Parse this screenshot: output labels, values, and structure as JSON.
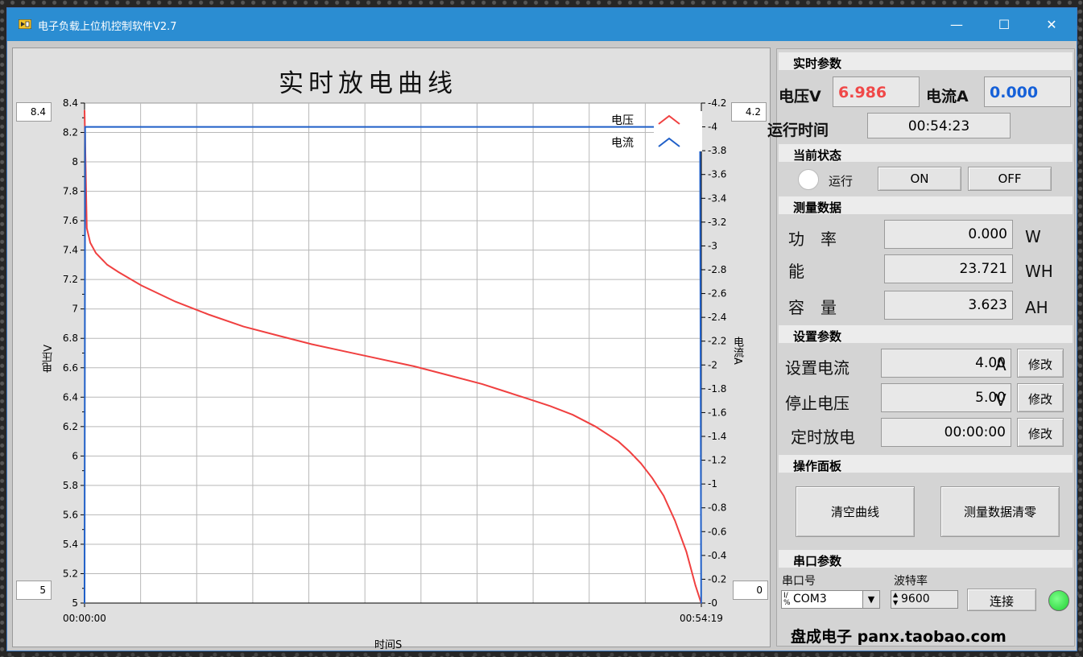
{
  "window": {
    "title": "电子负载上位机控制软件V2.7",
    "min": "—",
    "max": "☐",
    "close": "✕"
  },
  "chart": {
    "title": "实时放电曲线",
    "left_max_box": "8.4",
    "left_min_box": "5",
    "right_max_box": "4.2",
    "right_min_box": "0",
    "xlabel": "时间S",
    "ylabel_left": "电压V",
    "ylabel_right": "电流A",
    "x_start_label": "00:00:00",
    "x_end_label": "00:54:19",
    "legend": [
      "电压",
      "电流"
    ]
  },
  "chart_data": {
    "type": "line",
    "title": "实时放电曲线",
    "xlabel": "时间S",
    "ylabel": "电压V",
    "y2label": "电流A",
    "xlim": [
      "00:00:00",
      "00:54:19"
    ],
    "ylim": [
      5,
      8.4
    ],
    "y2lim": [
      0,
      4.2
    ],
    "yticks": [
      "5",
      "5.2",
      "5.4",
      "5.6",
      "5.8",
      "6",
      "6.2",
      "6.4",
      "6.6",
      "6.8",
      "7",
      "7.2",
      "7.4",
      "7.6",
      "7.8",
      "8",
      "8.2",
      "8.4"
    ],
    "y2ticks": [
      "0",
      "0.2",
      "0.4",
      "0.6",
      "0.8",
      "1",
      "1.2",
      "1.4",
      "1.6",
      "1.8",
      "2",
      "2.2",
      "2.4",
      "2.6",
      "2.8",
      "3",
      "3.2",
      "3.4",
      "3.6",
      "3.8",
      "4",
      "4.2"
    ],
    "grid": true,
    "legend_position": "top-right",
    "series": [
      {
        "name": "电压",
        "axis": "left",
        "color": "#f04040",
        "x": [
          0,
          0.2,
          0.5,
          1,
          2,
          3,
          5,
          8,
          11,
          14,
          17,
          20,
          23,
          26,
          29,
          32,
          35,
          37,
          39,
          41,
          43,
          45,
          47,
          48,
          49,
          50,
          51,
          52,
          53,
          53.8,
          54.3
        ],
        "values": [
          8.35,
          7.55,
          7.45,
          7.38,
          7.3,
          7.25,
          7.16,
          7.05,
          6.96,
          6.88,
          6.82,
          6.76,
          6.71,
          6.66,
          6.61,
          6.55,
          6.49,
          6.44,
          6.39,
          6.34,
          6.28,
          6.2,
          6.1,
          6.03,
          5.95,
          5.85,
          5.73,
          5.56,
          5.35,
          5.12,
          5.0
        ]
      },
      {
        "name": "电流",
        "axis": "right",
        "color": "#1f5fc8",
        "x": [
          0,
          0.05,
          54.2,
          54.3
        ],
        "values": [
          0,
          4.0,
          4.0,
          0
        ]
      }
    ]
  },
  "panel": {
    "realtime_header": "实时参数",
    "voltage_label": "电压V",
    "voltage_value": "6.986",
    "current_label": "电流A",
    "current_value": "0.000",
    "runtime_label": "运行时间",
    "runtime_value": "00:54:23",
    "state_header": "当前状态",
    "state_text": "运行",
    "on_label": "ON",
    "off_label": "OFF",
    "measure_header": "测量数据",
    "power_label": "功　率",
    "power_value": "0.000",
    "power_unit": "W",
    "energy_label": "能",
    "energy_value": "23.721",
    "energy_unit": "WH",
    "capacity_label": "容　量",
    "capacity_value": "3.623",
    "capacity_unit": "AH",
    "settings_header": "设置参数",
    "set_current_label": "设置电流",
    "set_current_value": "4.00",
    "set_current_unit": "A",
    "stop_voltage_label": "停止电压",
    "stop_voltage_value": "5.00",
    "stop_voltage_unit": "V",
    "timer_label": "定时放电",
    "timer_value": "00:00:00",
    "modify_label": "修改",
    "ops_header": "操作面板",
    "clear_curve": "清空曲线",
    "clear_measure": "测量数据清零",
    "serial_header": "串口参数",
    "port_label": "串口号",
    "port_value": "COM3",
    "baud_label": "波特率",
    "baud_value": "9600",
    "connect_label": "连接",
    "footer": "盘成电子 panx.taobao.com",
    "colors": {
      "voltage": "#f04848",
      "current": "#1560d8",
      "led": "#1fcf32"
    }
  }
}
